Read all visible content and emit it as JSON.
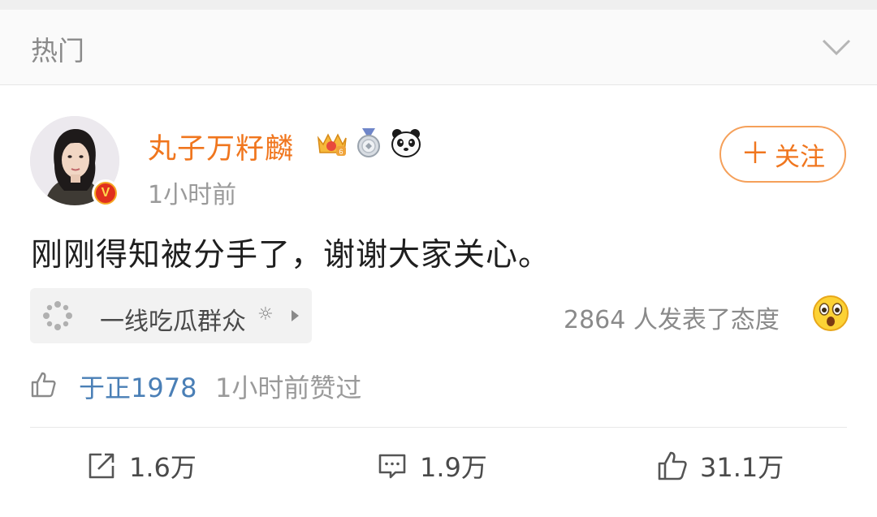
{
  "header": {
    "title": "热门",
    "expand_icon": "chevron-down-icon"
  },
  "post": {
    "user": {
      "name": "丸子万籽麟",
      "verified_badge": "V",
      "badges": [
        "crown-level-icon",
        "medal-icon",
        "panda-icon"
      ]
    },
    "time": "1小时前",
    "follow_label": "关注",
    "text": "刚刚得知被分手了，谢谢大家关心。",
    "topic": {
      "icon": "sparkle-icon",
      "label": "一线吃瓜群众"
    },
    "attitude": {
      "text": "2864 人发表了态度",
      "emoji": "surprised-emoji-icon"
    },
    "liked_by": {
      "user": "于正1978",
      "suffix": "1小时前赞过"
    },
    "actions": {
      "repost": "1.6万",
      "comment": "1.9万",
      "like": "31.1万"
    }
  },
  "colors": {
    "username": "#f0761e",
    "follow_border": "#f5a05a",
    "link_blue": "#4a7fb6"
  }
}
